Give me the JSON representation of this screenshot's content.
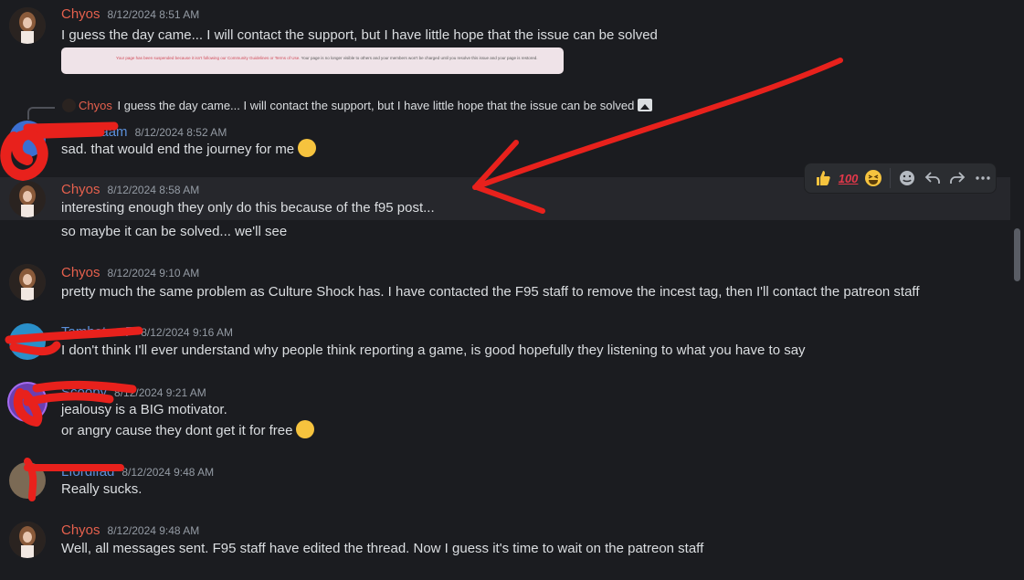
{
  "colors": {
    "background": "#1b1c20",
    "author_chyos": "#e5604d",
    "author_other": "#5b8fd9",
    "annotation": "#e8211c"
  },
  "messages": [
    {
      "author": "Chyos",
      "timestamp": "8/12/2024 8:51 AM",
      "lines": [
        "I guess the day came... I will contact the support, but I have little hope that the issue can be solved"
      ],
      "embed": {
        "title": "Your page has been suspended because it isn't following our Community Guidelines or Terms of Use.",
        "text": "Your page is no longer visible to others and your members won't be charged until you resolve this issue and your page is restored."
      }
    },
    {
      "reply_to": {
        "author": "Chyos",
        "text": "I guess the day came... I will contact the support, but I have little hope that the issue can be solved"
      },
      "author": "Seeedaam",
      "timestamp": "8/12/2024 8:52 AM",
      "lines": [
        "sad. that would end the journey for me"
      ],
      "emoji": "worried-face"
    },
    {
      "author": "Chyos",
      "timestamp": "8/12/2024 8:58 AM",
      "lines": [
        "interesting enough they only do this because of the f95 post...",
        "so maybe it can be solved... we'll see"
      ]
    },
    {
      "author": "Chyos",
      "timestamp": "8/12/2024 9:10 AM",
      "lines": [
        "pretty much the same problem as Culture Shock has. I have contacted the F95 staff to remove the incest tag, then I'll contact the patreon staff"
      ]
    },
    {
      "author": "Tambotoo F",
      "timestamp": "8/12/2024 9:16 AM",
      "lines": [
        "I don't think I'll ever understand why people think reporting a game, is good hopefully they listening to what you have to say"
      ]
    },
    {
      "author": "Scoopy",
      "timestamp": "8/12/2024 9:21 AM",
      "lines": [
        "jealousy is a BIG motivator.",
        "or angry cause they dont get it for free"
      ],
      "emoji": "grinning-squinting-face"
    },
    {
      "author": "Lfordlfad",
      "timestamp": "8/12/2024 9:48 AM",
      "lines": [
        "Really sucks."
      ]
    },
    {
      "author": "Chyos",
      "timestamp": "8/12/2024 9:48 AM",
      "lines": [
        "Well, all messages sent. F95 staff have edited the thread. Now I guess it's time to wait on the patreon staff"
      ]
    }
  ],
  "toolbar": {
    "reactions": [
      "thumbs-up",
      "hundred-points",
      "grinning-squinting-face"
    ],
    "actions": [
      "add-reaction-icon",
      "reply-icon",
      "forward-icon",
      "more-options-icon"
    ]
  }
}
